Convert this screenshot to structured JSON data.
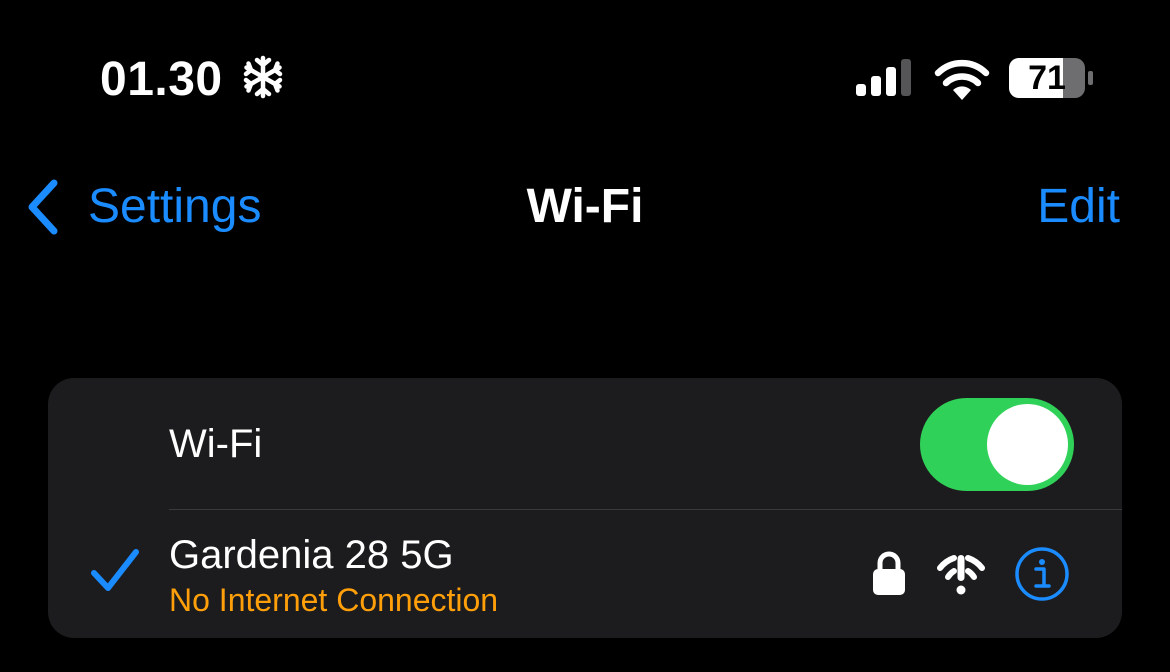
{
  "status_bar": {
    "time": "01.30",
    "battery_level": "71",
    "icons": [
      "snowflake-icon",
      "cellular-signal-icon",
      "wifi-icon",
      "battery-icon"
    ]
  },
  "nav": {
    "back_label": "Settings",
    "title": "Wi-Fi",
    "edit_label": "Edit"
  },
  "wifi_toggle": {
    "label": "Wi-Fi",
    "on": true
  },
  "network": {
    "name": "Gardenia 28 5G",
    "status": "No Internet Connection",
    "connected": true,
    "secured": true
  },
  "colors": {
    "background": "#000000",
    "card": "#1c1c1e",
    "accent": "#1a8cff",
    "toggle_on": "#30d158",
    "warning": "#ff9f0a"
  }
}
